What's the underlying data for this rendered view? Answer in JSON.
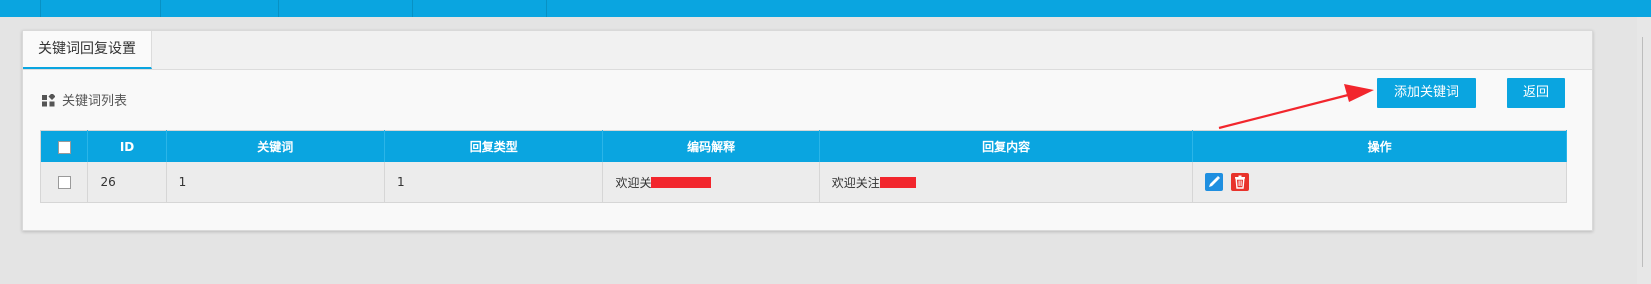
{
  "tab": {
    "label": "关键词回复设置"
  },
  "list": {
    "title": "关键词列表",
    "icon": "grid-icon"
  },
  "buttons": {
    "add": "添加关键词",
    "back": "返回"
  },
  "table": {
    "headers": {
      "checkbox": "",
      "id": "ID",
      "keyword": "关键词",
      "reply_type": "回复类型",
      "code_explain": "编码解释",
      "reply_content": "回复内容",
      "actions": "操作"
    },
    "rows": [
      {
        "id": "26",
        "keyword": "1",
        "reply_type": "1",
        "code_explain": "欢迎关",
        "reply_content": "欢迎关注",
        "actions": [
          "pencil-edit-icon",
          "trash-delete-icon"
        ]
      }
    ]
  },
  "colors": {
    "accent": "#0aa5e0",
    "delete": "#e8332b",
    "edit": "#1f8fe0",
    "annotation": "#f2262d"
  }
}
